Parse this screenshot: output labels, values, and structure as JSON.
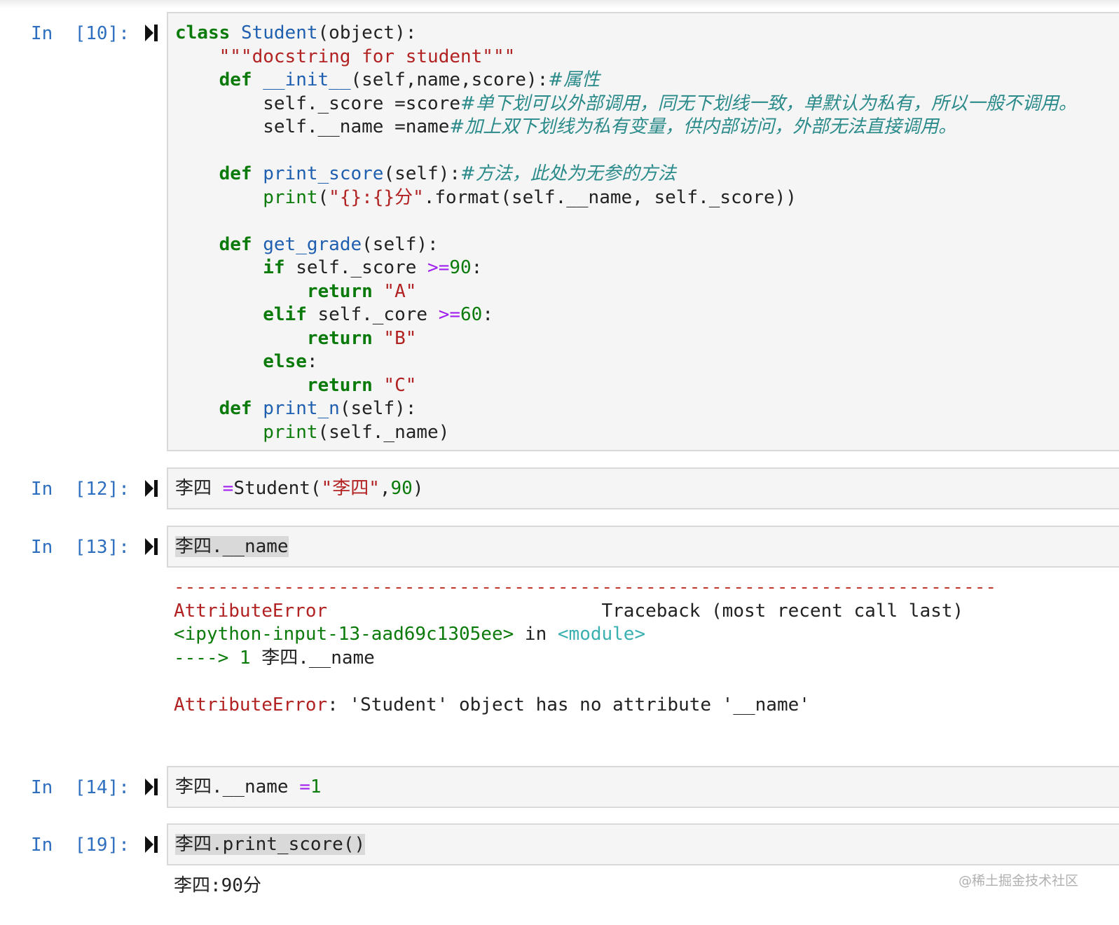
{
  "cells": [
    {
      "prompt": "In  [10]:"
    },
    {
      "prompt": "In  [12]:"
    },
    {
      "prompt": "In  [13]:"
    },
    {
      "prompt": "In  [14]:"
    },
    {
      "prompt": "In  [19]:"
    }
  ],
  "code10": {
    "l1_kw": "class",
    "l1_name": "Student",
    "l1_rest": "(object):",
    "l2_doc": "\"\"\"docstring for student\"\"\"",
    "l3_kw": "def",
    "l3_name": "__init__",
    "l3_rest": "(self,name,score):",
    "l3_cm": "#属性",
    "l4_code": "self._score =score",
    "l4_cm": "#单下划可以外部调用，同无下划线一致，单默认为私有，所以一般不调用。",
    "l5_code": "self.__name =name",
    "l5_cm": "#加上双下划线为私有变量，供内部访问，外部无法直接调用。",
    "l7_kw": "def",
    "l7_name": "print_score",
    "l7_rest": "(self):",
    "l7_cm": "#方法，此处为无参的方法",
    "l8_fn": "print",
    "l8_p1": "(",
    "l8_str": "\"{}:{}分\"",
    "l8_rest": ".format(self.__name, self._score))",
    "l10_kw": "def",
    "l10_name": "get_grade",
    "l10_rest": "(self):",
    "l11_kw": "if",
    "l11_code": " self._score ",
    "l11_op": ">=",
    "l11_num": "90",
    "l11_end": ":",
    "l12_kw": "return",
    "l12_str": "\"A\"",
    "l13_kw": "elif",
    "l13_code": " self._core ",
    "l13_op": ">=",
    "l13_num": "60",
    "l13_end": ":",
    "l14_kw": "return",
    "l14_str": "\"B\"",
    "l15_kw": "else",
    "l15_end": ":",
    "l16_kw": "return",
    "l16_str": "\"C\"",
    "l17_kw": "def",
    "l17_name": "print_n",
    "l17_rest": "(self):",
    "l18_fn": "print",
    "l18_rest": "(self._name)"
  },
  "code12": {
    "var": "李四 ",
    "op": "=",
    "cls": "Student(",
    "str": "\"李四\"",
    "comma": ",",
    "num": "90",
    "end": ")"
  },
  "code13": {
    "text": "李四.__name"
  },
  "error13": {
    "rule": "---------------------------------------------------------------------------",
    "name": "AttributeError",
    "traceback": "Traceback (most recent call last)",
    "input_ref": "<ipython-input-13-aad69c1305ee>",
    "in_word": " in ",
    "module": "<module>",
    "arrow": "---->",
    "line_no": " 1 ",
    "line_code": "李四.__name",
    "msg_name": "AttributeError",
    "msg": ": 'Student' object has no attribute '__name'"
  },
  "code14": {
    "code": "李四.__name ",
    "op": "=",
    "num": "1"
  },
  "code19": {
    "text": "李四.print_score()"
  },
  "output19": {
    "text": "李四:90分"
  },
  "watermark": "@稀土掘金技术社区",
  "colors": {
    "prompt": "#2f6fbf",
    "keyword": "#0a7a0a",
    "string": "#b22222",
    "function": "#1f5fb0",
    "comment": "#2b8a8a",
    "operator": "#a020f0"
  }
}
